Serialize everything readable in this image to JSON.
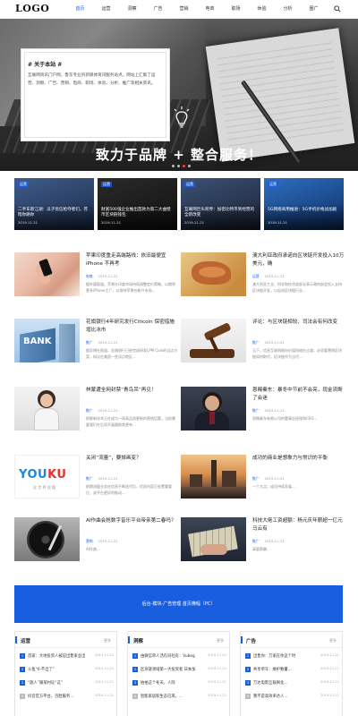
{
  "header": {
    "logo": "LOGO",
    "nav": [
      "首页",
      "运营",
      "洞察",
      "广告",
      "营销",
      "电商",
      "职场",
      "休验",
      "分析",
      "圈广"
    ]
  },
  "hero": {
    "about_title": "# 关于本站 #",
    "about_text": "互联网资讯门户网，鲁东专业的新媒体资讯服务站点，网站上汇集了运营、洞察、广告、营销、电商、职场、体验、分析、推广等相关资讯。",
    "slogan": "致力于品牌 + 整合服务！"
  },
  "cards": [
    {
      "tag": "运营",
      "title": "二手车新江湖：瓜子优信抢夺者们，苍暗你路你",
      "date": "2019-11-21",
      "colors": [
        "#3f5c8a",
        "#1c2c4a"
      ]
    },
    {
      "tag": "运营",
      "title": "财富500强企业推出首款为第二大曲壁币区块链钱包",
      "date": "2019-11-21",
      "colors": [
        "#2a2a2a",
        "#111"
      ]
    },
    {
      "tag": "运营",
      "title": "互联网巨头跨界：加密比特币到经营的全新改变",
      "date": "2019-11-21",
      "colors": [
        "#3c5277",
        "#1b2232"
      ]
    },
    {
      "tag": "运营",
      "title": "5G网络商用推进：5G手机价格战加剧",
      "date": "2019-11-21",
      "colors": [
        "#2f6fc0",
        "#0e2f66"
      ]
    }
  ],
  "articles": [
    {
      "title": "苹果印度重走高端路线：依旧最便宜iPhone 不再考",
      "cat": "电商",
      "date": "2019-11-21",
      "desc": "据外媒报道，苹果在印度市场持续调整定价策略，以期将更多iPhone工厂，以保持苹果在新兴市场..."
    },
    {
      "title": "澳大利亚政府承诺向区块链开发投入10万美元，确",
      "cat": "运营",
      "date": "2019-11-21",
      "desc": "澳大利亚工业、科学和技术部部长表示政府部会投入支持区块链开发，以促进区块链行业..."
    },
    {
      "title": "花旗银行4年研究发行Citicoin 保密措施增比冰市",
      "cat": "推广",
      "date": "2019-11-21",
      "desc": "据彭博社报道，花旗银行已经完成研发LPM Coin的试点方案，拟议在美国一些试点地区..."
    },
    {
      "title": "评论：与区块链相较，司法会有何改变",
      "cat": "推广",
      "date": "2019-11-21",
      "desc": "当下，信息互联网络向价值网络在过渡，必须要营销区块链如何取代，区块链作为当代..."
    },
    {
      "title": "林蒙遭全网封禁“青鸟吊”再见！",
      "cat": "推广",
      "date": "2019-11-21",
      "desc": "财联新技术正在成为一场高品质更新的营销话题，当前需要我们在后续开展跟踪其更有..."
    },
    {
      "title": "恩赐秦东：暴冬中节前不会亮，现金流断了会迷",
      "cat": "推广",
      "date": "2019-11-21",
      "desc": "恩赐秦东有限公司的董事总经理和CEO..."
    },
    {
      "title": "关闭“流量”，要掉画变？",
      "cat": "推广",
      "date": "2019-11-21",
      "desc": "前期流量业务在信息不断迭代后，优质内容正处置重要位，该平台更好的推动..."
    },
    {
      "title": "成功的商业是想象力与常识的平衡",
      "cat": "推广",
      "date": "2019-11-21",
      "desc": "一个大点，成员持续发展..."
    },
    {
      "title": "AI作曲会抢数字音乐平台帝亲第二春吗？",
      "cat": "营销",
      "date": "2019-11-21",
      "desc": "AI作曲..."
    },
    {
      "title": "科技大佬工资超额：杨元庆年薪超一亿元 马云有",
      "cat": "推广",
      "date": "2019-11-21",
      "desc": "高管薪酬..."
    }
  ],
  "banner": {
    "text": "后台-模块-广告管理 首页横幅（PC）"
  },
  "lists": [
    {
      "title": "运营",
      "more": "更多",
      "items": [
        {
          "t": "首家：大地投资人被迫出售家业出",
          "d": "2019-11-21"
        },
        {
          "t": "斗鱼“6·不出了”",
          "d": "2019-11-21"
        },
        {
          "t": "“跑人”跟某村证“这”",
          "d": "2019-11-21"
        },
        {
          "t": "抖音官方平台，百胜服务...",
          "d": "2019-11-21"
        }
      ]
    },
    {
      "title": "洞察",
      "more": "更多",
      "items": [
        {
          "t": "由微信单人活在同社有：Vubeg",
          "d": "2019-11-21"
        },
        {
          "t": "区块链领域第一大投资者 日本加",
          "d": "2019-11-21"
        },
        {
          "t": "拍拍这个冬天，人际",
          "d": "2019-11-21"
        },
        {
          "t": "智能家居新生态已来，...",
          "d": "2019-11-21"
        }
      ]
    },
    {
      "title": "广告",
      "more": "更多",
      "items": [
        {
          "t": "出售你：万家在你这个时",
          "d": "2019-11-21"
        },
        {
          "t": "共享单车：维护数量...",
          "d": "2019-11-21"
        },
        {
          "t": "万达电影互联网化...",
          "d": "2019-11-21"
        },
        {
          "t": "我不是高效率达人...",
          "d": "2019-11-21"
        }
      ]
    }
  ],
  "accent": "#1a5ee0"
}
